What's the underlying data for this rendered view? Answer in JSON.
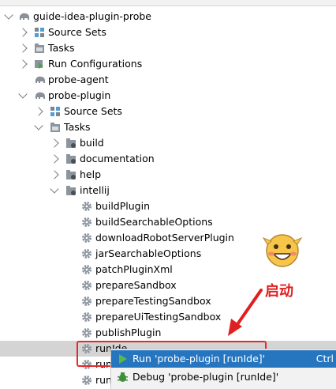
{
  "tree": {
    "root": "guide-idea-plugin-probe",
    "items": [
      {
        "label": "Source Sets"
      },
      {
        "label": "Tasks"
      },
      {
        "label": "Run Configurations"
      },
      {
        "label": "probe-agent"
      },
      {
        "label": "probe-plugin"
      },
      {
        "label": "Source Sets"
      },
      {
        "label": "Tasks"
      },
      {
        "label": "build"
      },
      {
        "label": "documentation"
      },
      {
        "label": "help"
      },
      {
        "label": "intellij"
      },
      {
        "label": "buildPlugin"
      },
      {
        "label": "buildSearchableOptions"
      },
      {
        "label": "downloadRobotServerPlugin"
      },
      {
        "label": "jarSearchableOptions"
      },
      {
        "label": "patchPluginXml"
      },
      {
        "label": "prepareSandbox"
      },
      {
        "label": "prepareTestingSandbox"
      },
      {
        "label": "prepareUiTestingSandbox"
      },
      {
        "label": "publishPlugin"
      },
      {
        "label": "runIde"
      },
      {
        "label": "runI"
      },
      {
        "label": "runI"
      }
    ]
  },
  "context_menu": {
    "run_label": "Run 'probe-plugin [runIde]'",
    "run_shortcut": "Ctrl",
    "debug_label": "Debug 'probe-plugin [runIde]'"
  },
  "annotation": {
    "text": "启动",
    "color": "#e02020"
  }
}
